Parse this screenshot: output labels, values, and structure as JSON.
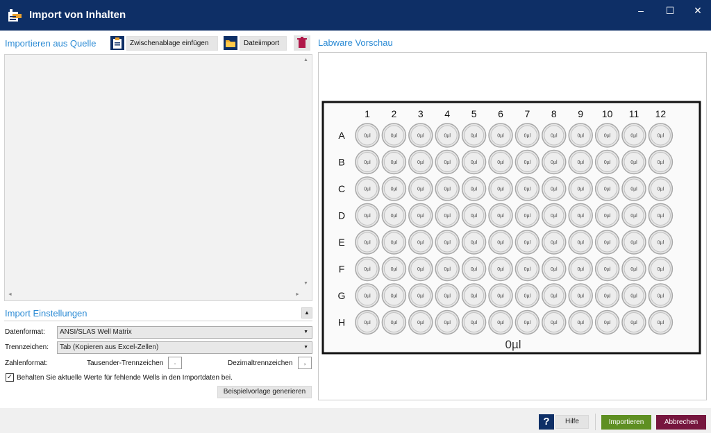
{
  "window": {
    "title": "Import von Inhalten",
    "minimize_glyph": "–",
    "maximize_glyph": "☐",
    "close_glyph": "✕",
    "icon": "import-window-icon"
  },
  "colors": {
    "titlebar": "#0e2f66",
    "section_title": "#2a8ad4",
    "import_button": "#5e8f22",
    "cancel_button": "#76163e"
  },
  "source": {
    "heading": "Importieren aus Quelle",
    "paste_label": "Zwischenablage einfügen",
    "paste_icon": "clipboard-icon",
    "file_label": "Dateiimport",
    "file_icon": "folder-icon",
    "clear_icon": "trash-icon",
    "scroll_up": "▲",
    "scroll_down": "▼",
    "scroll_left": "◄",
    "scroll_right": "►"
  },
  "settings": {
    "heading": "Import Einstellungen",
    "collapse_glyph": "▲",
    "format_label": "Datenformat:",
    "format_value": "ANSI/SLAS Well Matrix",
    "delimiter_label": "Trennzeichen:",
    "delimiter_value": "Tab (Kopieren aus Excel-Zellen)",
    "caret": "▼",
    "number_format_label": "Zahlenformat:",
    "thousands_label": "Tausender-Trennzeichen",
    "thousands_value": ".",
    "decimal_label": "Dezimaltrennzeichen",
    "decimal_value": ",",
    "keep_values_label": "Behalten Sie aktuelle Werte für fehlende Wells in den Importdaten bei.",
    "keep_values_checked": true,
    "check_glyph": "✓",
    "generate_label": "Beispielvorlage generieren"
  },
  "preview": {
    "heading": "Labware Vorschau",
    "columns": [
      "1",
      "2",
      "3",
      "4",
      "5",
      "6",
      "7",
      "8",
      "9",
      "10",
      "11",
      "12"
    ],
    "rows": [
      "A",
      "B",
      "C",
      "D",
      "E",
      "F",
      "G",
      "H"
    ],
    "well_value": "0µl",
    "total_label": "0µl"
  },
  "footer": {
    "help_glyph": "?",
    "help_label": "Hilfe",
    "import_label": "Importieren",
    "cancel_label": "Abbrechen"
  }
}
